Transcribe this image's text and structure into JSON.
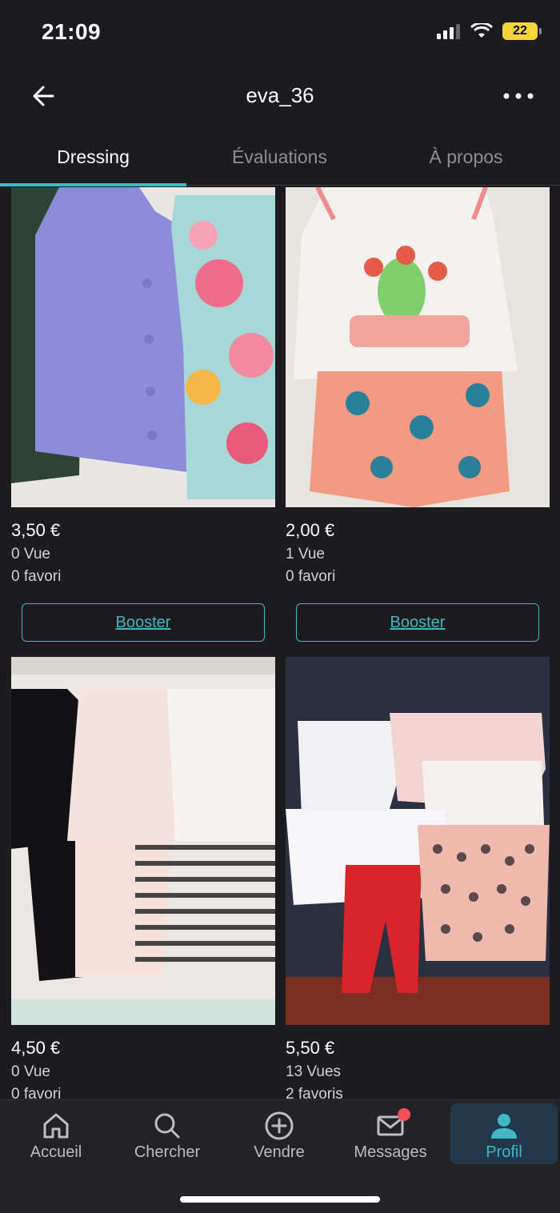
{
  "status_bar": {
    "time": "21:09",
    "battery": "22"
  },
  "header": {
    "title": "eva_36"
  },
  "tabs": [
    {
      "label": "Dressing"
    },
    {
      "label": "Évaluations"
    },
    {
      "label": "À propos"
    }
  ],
  "items": [
    {
      "price": "3,50 €",
      "views": "0 Vue",
      "favorites": "0 favori",
      "booster_label": "Booster"
    },
    {
      "price": "2,00 €",
      "views": "1 Vue",
      "favorites": "0 favori",
      "booster_label": "Booster"
    },
    {
      "price": "4,50 €",
      "views": "0 Vue",
      "favorites": "0 favori"
    },
    {
      "price": "5,50 €",
      "views": "13 Vues",
      "favorites": "2 favoris"
    }
  ],
  "nav": [
    {
      "label": "Accueil",
      "icon": "home-icon"
    },
    {
      "label": "Chercher",
      "icon": "search-icon"
    },
    {
      "label": "Vendre",
      "icon": "plus-circle-icon"
    },
    {
      "label": "Messages",
      "icon": "mail-icon"
    },
    {
      "label": "Profil",
      "icon": "user-icon"
    }
  ],
  "colors": {
    "accent": "#3fb8c4",
    "background": "#1c1c1e",
    "notification": "#ff4d5a"
  }
}
